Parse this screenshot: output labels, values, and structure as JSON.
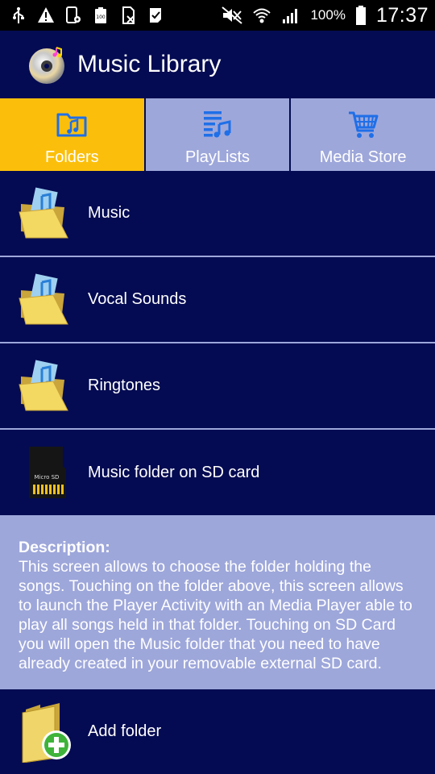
{
  "status_bar": {
    "icons_left": [
      "usb-icon",
      "warning-icon",
      "phone-settings-icon",
      "battery-full-icon",
      "sim-blocked-icon",
      "check-flag-icon"
    ],
    "battery_percent": "100%",
    "time": "17:37"
  },
  "app_bar": {
    "title": "Music Library",
    "logo": "cd-music-icon"
  },
  "tabs": [
    {
      "label": "Folders",
      "icon": "music-folder-icon",
      "active": true
    },
    {
      "label": "PlayLists",
      "icon": "playlist-icon",
      "active": false
    },
    {
      "label": "Media Store",
      "icon": "cart-icon",
      "active": false
    }
  ],
  "folders": [
    {
      "label": "Music",
      "icon": "music-folder-icon"
    },
    {
      "label": "Vocal Sounds",
      "icon": "music-folder-icon"
    },
    {
      "label": "Ringtones",
      "icon": "music-folder-icon"
    },
    {
      "label": "Music folder on SD card",
      "icon": "sd-card-icon",
      "chip_text": "Micro SD"
    }
  ],
  "description": {
    "title": "Description:",
    "text": "This screen allows to choose the folder holding the songs. Touching on the folder above, this screen allows to launch the Player Activity with an Media Player able to play all songs held in that folder. Touching on SD Card you will open the Music folder that you need to have already created in your removable external SD card."
  },
  "add_folder": {
    "label": "Add folder",
    "icon": "add-folder-icon"
  },
  "colors": {
    "primary_dark": "#040b52",
    "accent": "#fbbf0b",
    "light": "#9ea7da",
    "icon_blue": "#1f6fe8"
  }
}
